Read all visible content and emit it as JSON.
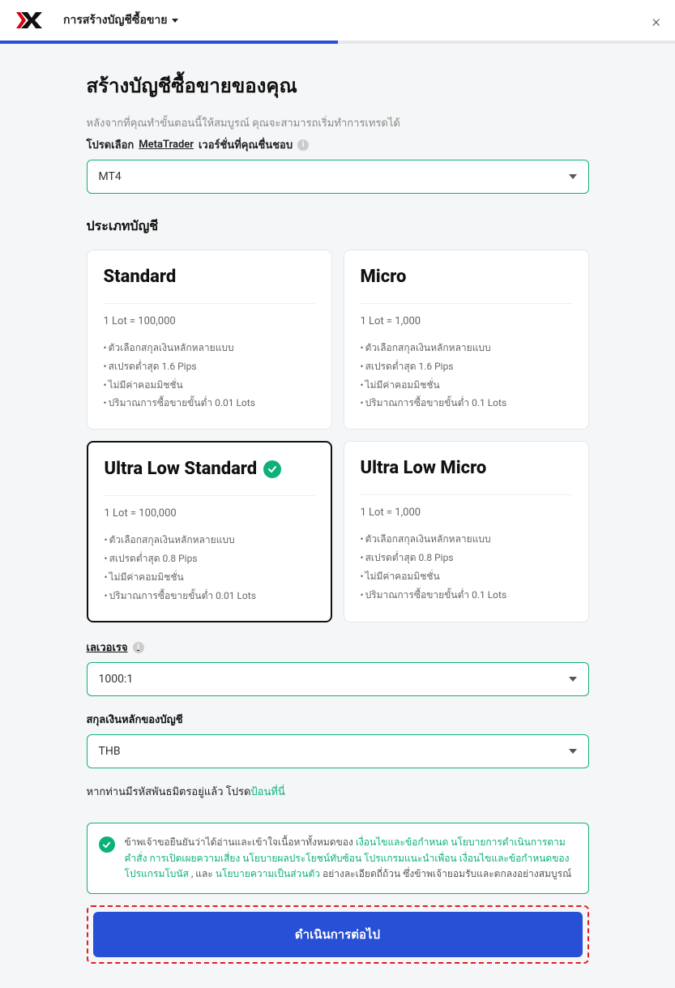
{
  "header": {
    "title": "การสร้างบัญชีซื้อขาย"
  },
  "page": {
    "heading": "สร้างบัญชีซื้อขายของคุณ",
    "subtitle": "หลังจากที่คุณทำขั้นตอนนี้ให้สมบูรณ์ คุณจะสามารถเริ่มทำการเทรดได้"
  },
  "platform": {
    "label_prefix": "โปรดเลือก",
    "label_underline": "MetaTrader",
    "label_suffix": "เวอร์ชั่นที่คุณชื่นชอบ",
    "value": "MT4"
  },
  "account_type": {
    "heading": "ประเภทบัญชี",
    "cards": [
      {
        "title": "Standard",
        "lot": "1 Lot = 100,000",
        "f1": "ตัวเลือกสกุลเงินหลักหลายแบบ",
        "f2": "สเปรดต่ำสุด 1.6 Pips",
        "f3": "ไม่มีค่าคอมมิชชั่น",
        "f4": "ปริมาณการซื้อขายขั้นต่ำ 0.01 Lots"
      },
      {
        "title": "Micro",
        "lot": "1 Lot = 1,000",
        "f1": "ตัวเลือกสกุลเงินหลักหลายแบบ",
        "f2": "สเปรดต่ำสุด 1.6 Pips",
        "f3": "ไม่มีค่าคอมมิชชั่น",
        "f4": "ปริมาณการซื้อขายขั้นต่ำ 0.1 Lots"
      },
      {
        "title": "Ultra Low Standard",
        "lot": "1 Lot = 100,000",
        "f1": "ตัวเลือกสกุลเงินหลักหลายแบบ",
        "f2": "สเปรดต่ำสุด 0.8 Pips",
        "f3": "ไม่มีค่าคอมมิชชั่น",
        "f4": "ปริมาณการซื้อขายขั้นต่ำ 0.01 Lots"
      },
      {
        "title": "Ultra Low Micro",
        "lot": "1 Lot = 1,000",
        "f1": "ตัวเลือกสกุลเงินหลักหลายแบบ",
        "f2": "สเปรดต่ำสุด 0.8 Pips",
        "f3": "ไม่มีค่าคอมมิชชั่น",
        "f4": "ปริมาณการซื้อขายขั้นต่ำ 0.1 Lots"
      }
    ]
  },
  "leverage": {
    "label": "เลเวอเรจ",
    "value": "1000:1"
  },
  "currency": {
    "label": "สกุลเงินหลักของบัญชี",
    "value": "THB"
  },
  "partner": {
    "prefix": "หากท่านมีรหัสพันธมิตรอยู่แล้ว โปรด",
    "link": "ป้อนที่นี่"
  },
  "consent": {
    "t1": "ข้าพเจ้าขอยืนยันว่าได้อ่านและเข้าใจเนื้อหาทั้งหมดของ",
    "l1": "เงื่อนไขและข้อกำหนด",
    "t2": " ",
    "l2": "นโยบายการดำเนินการตามคำสั่ง",
    "t3": " ",
    "l3": "การเปิดเผยความเสี่ยง",
    "t4": " ",
    "l4": "นโยบายผลประโยชน์ทับซ้อน",
    "t5": " ",
    "l5": "โปรแกรมแนะนำเพื่อน",
    "t6": " ",
    "l6": "เงื่อนไขและข้อกำหนดของโปรแกรมโบนัส",
    "t7": ", และ ",
    "l7": "นโยบายความเป็นส่วนตัว",
    "t8": "อย่างละเอียดถี่ถ้วน ซึ่งข้าพเจ้ายอมรับและตกลงอย่างสมบูรณ์"
  },
  "continue_label": "ดำเนินการต่อไป"
}
